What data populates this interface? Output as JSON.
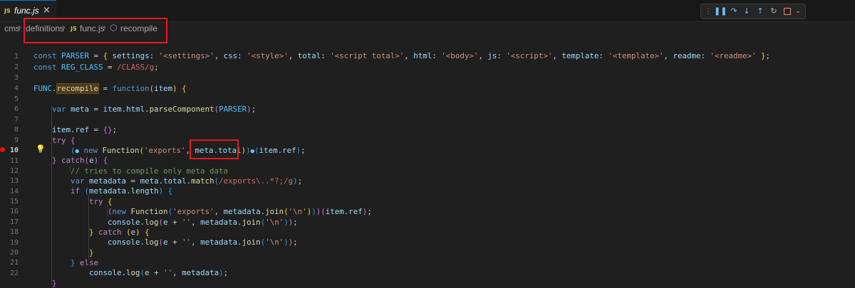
{
  "tab": {
    "lang_badge": "JS",
    "filename": "func.js",
    "close_glyph": "×"
  },
  "breadcrumb": [
    {
      "label": "cms"
    },
    {
      "label": "definitions"
    },
    {
      "label": "func.js",
      "badge": "JS"
    },
    {
      "label": "recompile"
    }
  ],
  "debug_toolbar": {
    "buttons": [
      "grip",
      "pause",
      "step-over",
      "step-into",
      "step-out",
      "restart",
      "stop",
      "more"
    ],
    "colors": {
      "blue": "#75beff",
      "green": "#89d185",
      "red": "#f48771"
    }
  },
  "editor": {
    "active_line": 10,
    "breakpoint_line": 10,
    "lines": [
      "1",
      "2",
      "3",
      "4",
      "5",
      "6",
      "7",
      "8",
      "9",
      "10",
      "11",
      "12",
      "13",
      "14",
      "15",
      "16",
      "17",
      "18",
      "19",
      "20",
      "21",
      "22"
    ]
  },
  "colors": {
    "annotation": "#e8191f",
    "accent": "#0078d4"
  }
}
